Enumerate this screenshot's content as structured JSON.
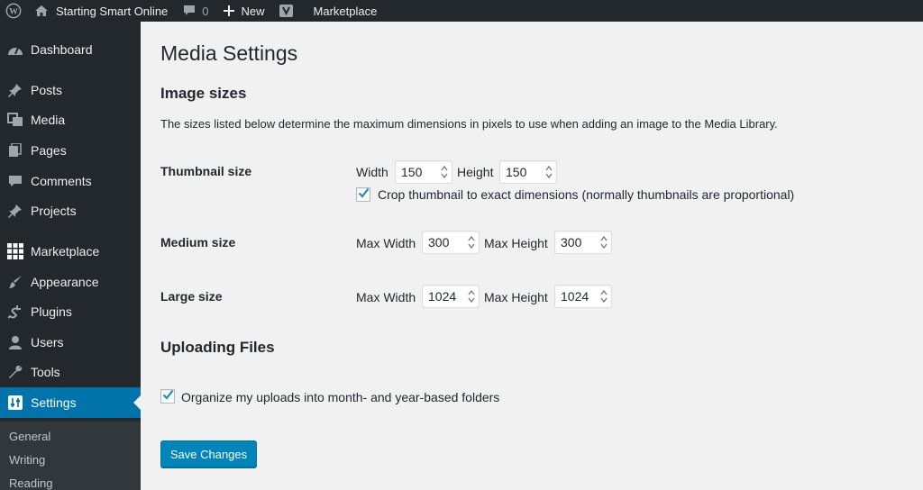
{
  "admin_bar": {
    "site_name": "Starting Smart Online",
    "comment_count": "0",
    "new_label": "New",
    "marketplace_label": "Marketplace"
  },
  "sidebar": {
    "items": [
      {
        "label": "Dashboard",
        "icon": "dashboard-icon"
      },
      {
        "label": "Posts",
        "icon": "pin-icon"
      },
      {
        "label": "Media",
        "icon": "media-icon"
      },
      {
        "label": "Pages",
        "icon": "pages-icon"
      },
      {
        "label": "Comments",
        "icon": "comment-icon"
      },
      {
        "label": "Projects",
        "icon": "pin-icon"
      },
      {
        "label": "Marketplace",
        "icon": "grid-icon"
      },
      {
        "label": "Appearance",
        "icon": "brush-icon"
      },
      {
        "label": "Plugins",
        "icon": "plug-icon"
      },
      {
        "label": "Users",
        "icon": "user-icon"
      },
      {
        "label": "Tools",
        "icon": "wrench-icon"
      },
      {
        "label": "Settings",
        "icon": "settings-icon"
      }
    ],
    "submenu": [
      "General",
      "Writing",
      "Reading"
    ]
  },
  "page": {
    "title": "Media Settings",
    "image_sizes_heading": "Image sizes",
    "description": "The sizes listed below determine the maximum dimensions in pixels to use when adding an image to the Media Library.",
    "thumbnail": {
      "label": "Thumbnail size",
      "width_label": "Width",
      "width": "150",
      "height_label": "Height",
      "height": "150",
      "crop_label": "Crop thumbnail to exact dimensions (normally thumbnails are proportional)",
      "crop_checked": true
    },
    "medium": {
      "label": "Medium size",
      "width_label": "Max Width",
      "width": "300",
      "height_label": "Max Height",
      "height": "300"
    },
    "large": {
      "label": "Large size",
      "width_label": "Max Width",
      "width": "1024",
      "height_label": "Max Height",
      "height": "1024"
    },
    "uploading_heading": "Uploading Files",
    "organize_label": "Organize my uploads into month- and year-based folders",
    "organize_checked": true,
    "save_button": "Save Changes"
  },
  "colors": {
    "admin_bg": "#23282d",
    "accent": "#0073aa",
    "button": "#0085ba",
    "content_bg": "#f1f1f1"
  }
}
